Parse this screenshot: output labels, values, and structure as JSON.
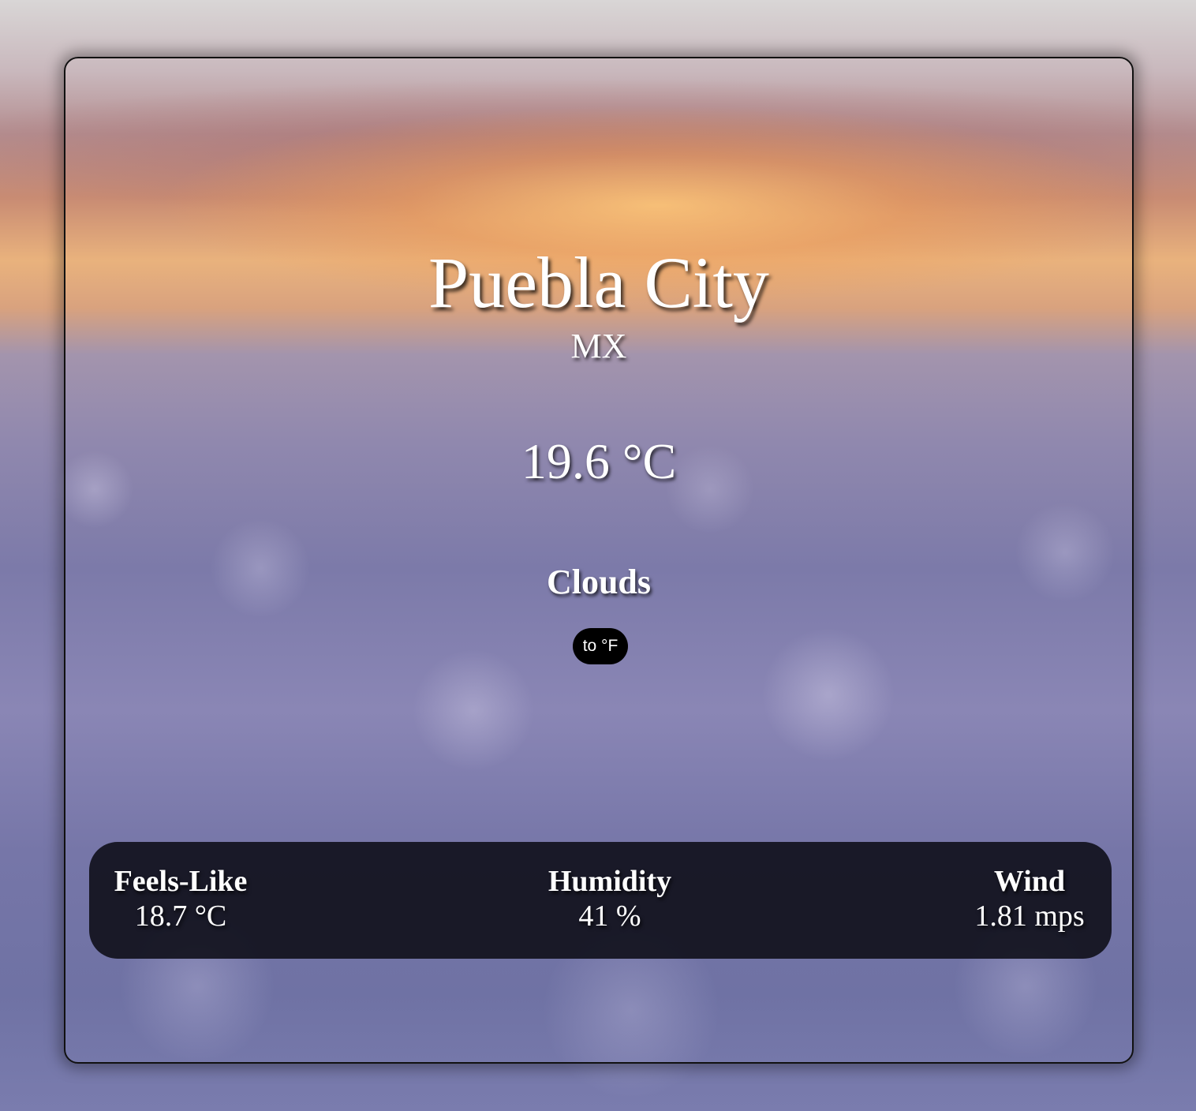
{
  "location": {
    "city": "Puebla City",
    "country": "MX"
  },
  "weather": {
    "temperature": "19.6 °C",
    "condition": "Clouds"
  },
  "controls": {
    "unit_toggle_label": "to °F"
  },
  "stats": {
    "feels_like": {
      "label": "Feels-Like",
      "value": "18.7 °C"
    },
    "humidity": {
      "label": "Humidity",
      "value": "41 %"
    },
    "wind": {
      "label": "Wind",
      "value": "1.81 mps"
    }
  }
}
